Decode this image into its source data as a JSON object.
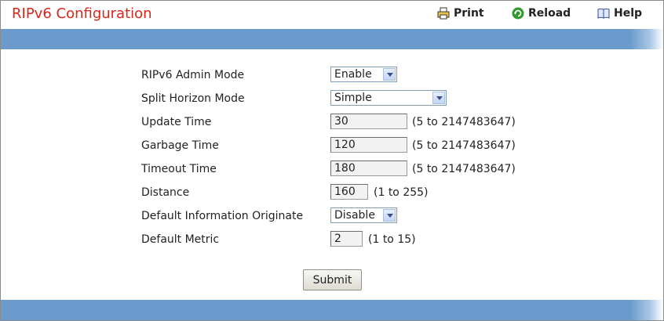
{
  "header": {
    "title": "RIPv6 Configuration",
    "print_label": "Print",
    "reload_label": "Reload",
    "help_label": "Help"
  },
  "icons": {
    "print": "printer-icon",
    "reload": "reload-icon",
    "help": "help-book-icon"
  },
  "colors": {
    "title": "#d9261c",
    "bar": "#6b9bcc"
  },
  "form": {
    "admin_mode": {
      "label": "RIPv6 Admin Mode",
      "value": "Enable"
    },
    "split_horizon": {
      "label": "Split Horizon Mode",
      "value": "Simple"
    },
    "update_time": {
      "label": "Update Time",
      "value": "30",
      "range": "(5 to 2147483647)"
    },
    "garbage_time": {
      "label": "Garbage Time",
      "value": "120",
      "range": "(5 to 2147483647)"
    },
    "timeout_time": {
      "label": "Timeout Time",
      "value": "180",
      "range": "(5 to 2147483647)"
    },
    "distance": {
      "label": "Distance",
      "value": "160",
      "range": "(1 to 255)"
    },
    "default_info_originate": {
      "label": "Default Information Originate",
      "value": "Disable"
    },
    "default_metric": {
      "label": "Default Metric",
      "value": "2",
      "range": "(1 to 15)"
    }
  },
  "submit_label": "Submit"
}
